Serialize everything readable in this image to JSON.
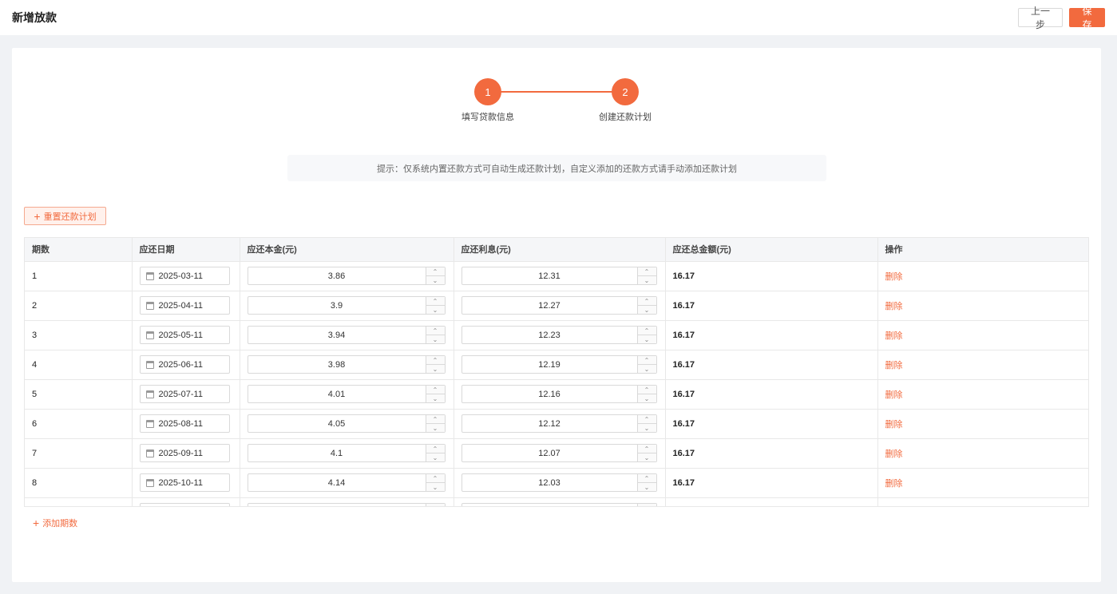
{
  "header": {
    "title": "新增放款",
    "prev_label": "上一步",
    "save_label": "保存"
  },
  "steps": [
    {
      "number": "1",
      "label": "填写贷款信息"
    },
    {
      "number": "2",
      "label": "创建还款计划"
    }
  ],
  "tip": "提示：仅系统内置还款方式可自动生成还款计划，自定义添加的还款方式请手动添加还款计划",
  "reset_label": "重置还款计划",
  "add_label": "添加期数",
  "table": {
    "columns": [
      "期数",
      "应还日期",
      "应还本金(元)",
      "应还利息(元)",
      "应还总金额(元)",
      "操作"
    ],
    "delete_label": "删除",
    "rows": [
      {
        "period": "1",
        "date": "2025-03-11",
        "principal": "3.86",
        "interest": "12.31",
        "total": "16.17"
      },
      {
        "period": "2",
        "date": "2025-04-11",
        "principal": "3.9",
        "interest": "12.27",
        "total": "16.17"
      },
      {
        "period": "3",
        "date": "2025-05-11",
        "principal": "3.94",
        "interest": "12.23",
        "total": "16.17"
      },
      {
        "period": "4",
        "date": "2025-06-11",
        "principal": "3.98",
        "interest": "12.19",
        "total": "16.17"
      },
      {
        "period": "5",
        "date": "2025-07-11",
        "principal": "4.01",
        "interest": "12.16",
        "total": "16.17"
      },
      {
        "period": "6",
        "date": "2025-08-11",
        "principal": "4.05",
        "interest": "12.12",
        "total": "16.17"
      },
      {
        "period": "7",
        "date": "2025-09-11",
        "principal": "4.1",
        "interest": "12.07",
        "total": "16.17"
      },
      {
        "period": "8",
        "date": "2025-10-11",
        "principal": "4.14",
        "interest": "12.03",
        "total": "16.17"
      }
    ]
  },
  "colors": {
    "accent": "#f26a3e"
  }
}
